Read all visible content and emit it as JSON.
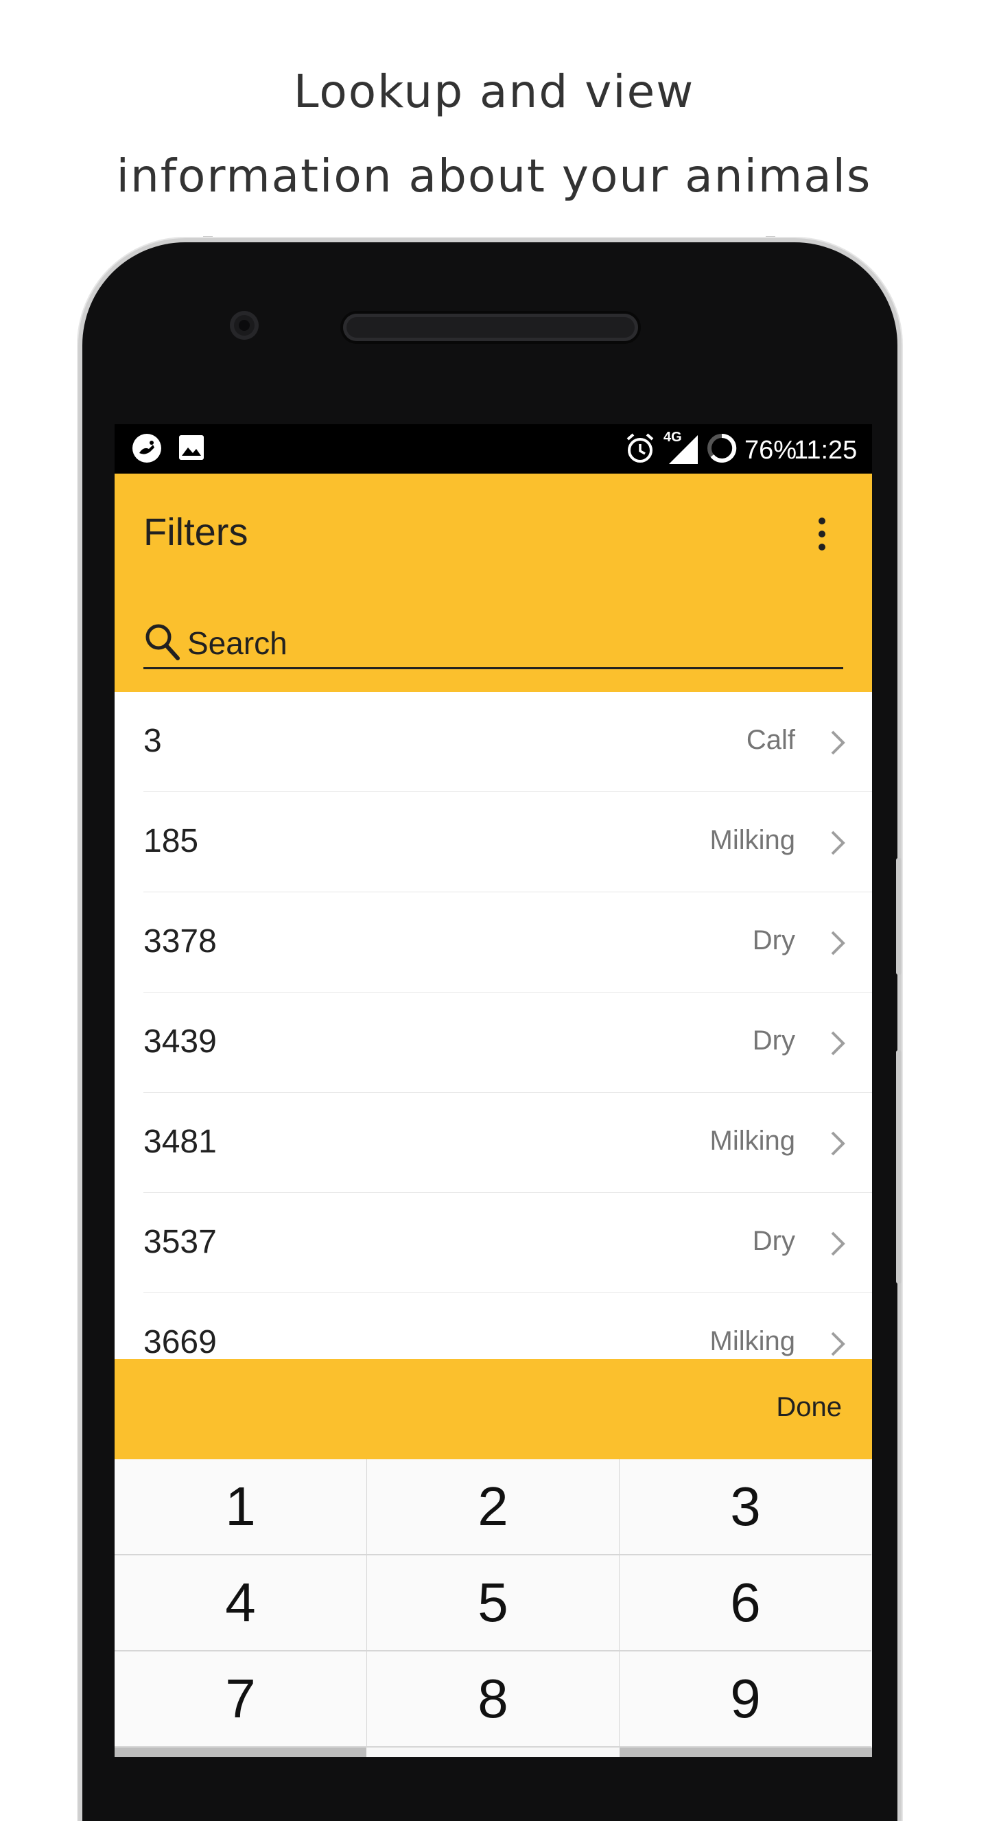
{
  "promo": {
    "line1": "Lookup and view",
    "line2": "information about your animals"
  },
  "status_bar": {
    "left_icons": [
      "app-notification-icon",
      "image-icon"
    ],
    "right_icons": [
      "alarm-icon",
      "4g-signal-icon",
      "battery-icon"
    ],
    "network": "4G",
    "battery": "76%",
    "time": "11:25"
  },
  "app_bar": {
    "title": "Filters",
    "menu_icon": "more-vert-icon",
    "search": {
      "icon": "search-icon",
      "placeholder": "Search"
    },
    "color": "#fbc02d"
  },
  "animals": [
    {
      "id": "3",
      "status": "Calf"
    },
    {
      "id": "185",
      "status": "Milking"
    },
    {
      "id": "3378",
      "status": "Dry"
    },
    {
      "id": "3439",
      "status": "Dry"
    },
    {
      "id": "3481",
      "status": "Milking"
    },
    {
      "id": "3537",
      "status": "Dry"
    },
    {
      "id": "3669",
      "status": "Milking"
    }
  ],
  "keyboard": {
    "done_label": "Done",
    "keys": [
      "1",
      "2",
      "3",
      "4",
      "5",
      "6",
      "7",
      "8",
      "9"
    ]
  }
}
